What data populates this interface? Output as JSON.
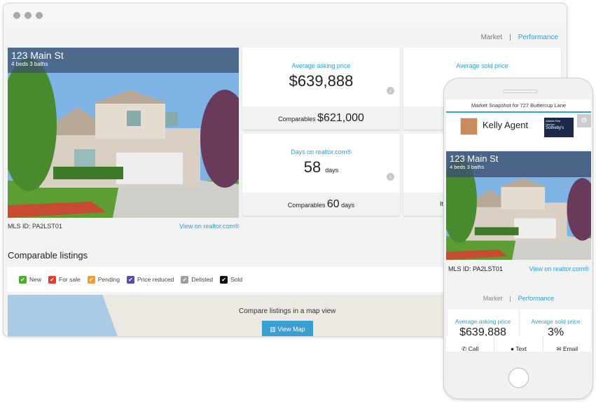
{
  "nav": {
    "market": "Market",
    "separator": "|",
    "performance": "Performance"
  },
  "listing": {
    "address": "123 Main St",
    "details": "4 beds 3 baths",
    "mls": "MLS ID: PA2LST01",
    "view_link": "View on realtor.com®"
  },
  "cards": [
    {
      "label": "Average asking price",
      "value": "$639,888",
      "foot_label": "Comparables",
      "foot_value": "$621,000"
    },
    {
      "label": "Average sold price",
      "value": "3%"
    },
    {
      "label": "Days on realtor.com®",
      "value": "58",
      "unit": "days",
      "foot_label": "Comparables",
      "foot_value": "60",
      "foot_unit": "days"
    },
    {
      "foot_label": "It"
    }
  ],
  "comparable": {
    "title": "Comparable listings",
    "filters": [
      {
        "label": "New",
        "color": "#4caf2a"
      },
      {
        "label": "For sale",
        "color": "#e53935"
      },
      {
        "label": "Pending",
        "color": "#f39c34"
      },
      {
        "label": "Price reduced",
        "color": "#5c4aa8"
      },
      {
        "label": "Delisted",
        "color": "#9e9e9e"
      },
      {
        "label": "Sold",
        "color": "#111111"
      }
    ],
    "map_text": "Compare listings in a map view",
    "map_button": "View Map"
  },
  "phone": {
    "snapshot": "Market Snapshot for 727 Buttercup Lane",
    "agent": "Kelly Agent",
    "brokerage_logo": "Atlanta Fine Homes Sotheby's",
    "actions": [
      "Call",
      "Text",
      "Email"
    ],
    "asking_value": "$639,888"
  }
}
